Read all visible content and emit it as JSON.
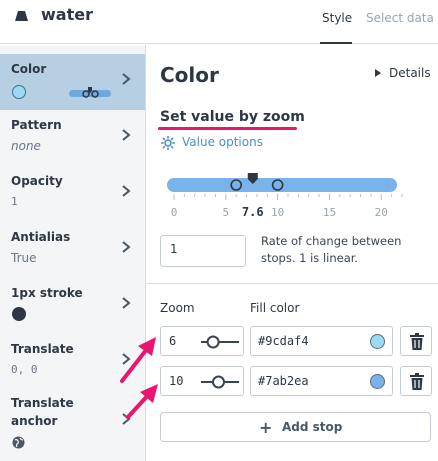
{
  "header": {
    "layer_name": "water",
    "tabs": [
      {
        "label": "Style",
        "active": true
      },
      {
        "label": "Select data",
        "active": false
      }
    ]
  },
  "sidebar": {
    "items": [
      {
        "label": "Color",
        "value": "",
        "swatch": "#9cdaf4",
        "active": true
      },
      {
        "label": "Pattern",
        "value": "none"
      },
      {
        "label": "Opacity",
        "value": "1"
      },
      {
        "label": "Antialias",
        "value": "True"
      },
      {
        "label": "1px stroke",
        "value": "",
        "swatch": "#2d3844"
      },
      {
        "label": "Translate",
        "value": "0, 0"
      },
      {
        "label": "Translate anchor",
        "value": "",
        "icon": "globe-icon"
      }
    ]
  },
  "main": {
    "title": "Color",
    "details_label": "Details",
    "mode_label": "Set value by zoom",
    "value_options_label": "Value options",
    "zoom_slider": {
      "min": 0,
      "max": 22,
      "ticks": [
        "0",
        "5",
        "10",
        "15",
        "20"
      ],
      "current_zoom": 7.6,
      "current_label": "7.6",
      "stops": [
        6,
        10
      ]
    },
    "rate_value": "1",
    "rate_help": "Rate of change between stops. 1 is linear.",
    "columns": {
      "zoom": "Zoom",
      "fill": "Fill color"
    },
    "stops": [
      {
        "zoom": "6",
        "color": "#9cdaf4",
        "slider_level": 0.27
      },
      {
        "zoom": "10",
        "color": "#7ab2ea",
        "slider_level": 0.45
      }
    ],
    "add_stop_label": "Add stop"
  },
  "colors": {
    "accent": "#4a90c8",
    "highlight": "#e8166e",
    "active_sidebar": "#b7cfe3"
  }
}
